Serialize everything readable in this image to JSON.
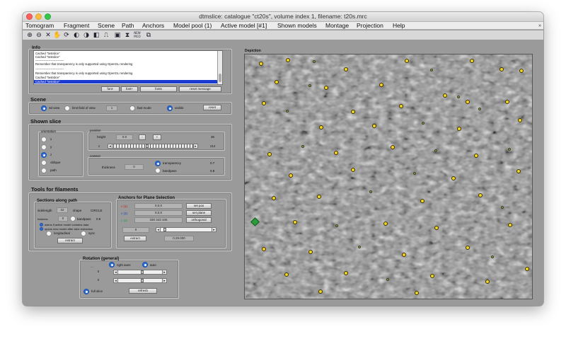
{
  "window": {
    "title": "dtmslice: catalogue \"ct20s\", volume index 1, filename: t20s.mrc"
  },
  "menu": [
    "Tomogram",
    "Fragment",
    "Scene",
    "Path",
    "Anchors",
    "Model pool (1)",
    "Active model [#1]",
    "Shown models",
    "Montage",
    "Projection",
    "Help"
  ],
  "menu_overflow": "»",
  "toolbar": {
    "icons": [
      "zoom-in-icon",
      "zoom-out-icon",
      "fit-icon",
      "hand-icon",
      "rotate-icon",
      "contrast-icon",
      "invert-icon",
      "contrast2-icon",
      "histogram-icon",
      "save-icon",
      "filter-icon",
      "new-mco-icon",
      "copy-icon"
    ],
    "glyphs": [
      "⊕",
      "⊖",
      "✕",
      "✋",
      "⟳",
      "◐",
      "◑",
      "◧",
      "⎍",
      "▣",
      "⧗",
      "",
      "⧉"
    ],
    "mco_label": "NEW MCO"
  },
  "info": {
    "title": "Info",
    "log": [
      "Cached \"testslice\"",
      "Cached \"testslice\"",
      "----------------------------",
      "Remember that transparency is only supported using OpenGL rendering",
      "----------------------------",
      "Remember that transparency is only supported using OpenGL rendering",
      "Cached \"testslice\"",
      "Cached \"testslice\""
    ],
    "buttons": {
      "font_minus": "font-",
      "font_plus": "font+",
      "fonts": "fonts",
      "reset": "reset message"
    }
  },
  "scene": {
    "title": "Scene",
    "view_3d": "3d view",
    "limit_fov": "limit field of view",
    "fov_value": "1",
    "fast_mode": "fast mode",
    "visible": "visible",
    "reset": "reset"
  },
  "shown_slice": {
    "title": "Shown slice",
    "orientation_title": "orientation",
    "orientations": [
      "x",
      "y",
      "z",
      "oblique",
      "path"
    ],
    "selected": "z",
    "position_title": "position",
    "height_label": "height",
    "height_value": "0.0",
    "minus": "-",
    "plus": "+",
    "height_max": "36",
    "z_label": "z",
    "z_value": "214",
    "z_fraction": 0.42,
    "content_title": "content",
    "thickness_label": "thickness",
    "thickness_value": "0",
    "transparency_label": "transparency",
    "transparency_value": "0.7",
    "bandpass_label": "bandpass",
    "bandpass_value": "0.8"
  },
  "filaments": {
    "title": "Tools for filaments",
    "sections": {
      "title": "Sections along path",
      "sidelength_label": "sidelength",
      "sidelength_value": "32",
      "shape_label": "shape",
      "shape_value": "CIRCLE",
      "thickness_label": "thickness",
      "thickness_value": "0",
      "bandpass_label": "bandpass",
      "bandpass_value": "0.8",
      "warn_label": "warns if active model contains data",
      "open_label": "opens new model after slice extraction",
      "longitudinal": "longitudinal",
      "sync": "sync",
      "extract": "extract"
    },
    "anchors": {
      "title": "Anchors for Plane Selection",
      "c1_label": "c (1)",
      "c1_value": "0,0,0",
      "c2_label": "c (2)",
      "c2_value": "0,0,0",
      "c3_label": "c (3)",
      "c3_value": "330 343 105",
      "set_pos": "set pos",
      "set_plane": "set plane",
      "orthogonal": "orthogonal",
      "offset_value": "0",
      "extract": "extract",
      "extract_value": "0.29.000"
    }
  },
  "rotation": {
    "title": "Rotation (general)",
    "right_axes": "right axes",
    "auto": "auto",
    "label1": "...",
    "row1_value": "0",
    "row2_value": "0",
    "full_slice": "full slice",
    "refresh": "refresh"
  },
  "depiction": {
    "title": "Depiction"
  }
}
